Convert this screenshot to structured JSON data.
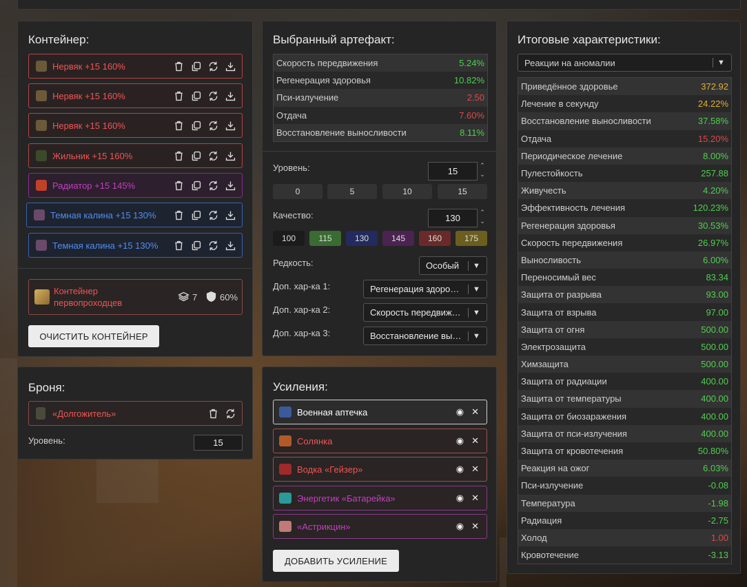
{
  "container": {
    "title": "Контейнер:",
    "items": [
      {
        "label": "Нервяк +15 160%",
        "color": "red",
        "art": "#6b5a3a"
      },
      {
        "label": "Нервяк +15 160%",
        "color": "red",
        "art": "#6b5a3a"
      },
      {
        "label": "Нервяк +15 160%",
        "color": "red",
        "art": "#6b5a3a"
      },
      {
        "label": "Жильник +15 160%",
        "color": "red",
        "art": "#3a4a2a"
      },
      {
        "label": "Радиатор +15 145%",
        "color": "purple",
        "art": "#c0402a"
      },
      {
        "label": "Темная калина +15 130%",
        "color": "blue",
        "art": "#6a4a6a"
      },
      {
        "label": "Темная калина +15 130%",
        "color": "blue",
        "art": "#6a4a6a"
      }
    ],
    "selected_container": {
      "name_line1": "Контейнер",
      "name_line2": "первопроходцев",
      "slots": "7",
      "protection": "60%"
    },
    "clear_button": "ОЧИСТИТЬ КОНТЕЙНЕР"
  },
  "armor": {
    "title": "Броня:",
    "item": "«Долгожитель»",
    "level_label": "Уровень:",
    "level_value": "15"
  },
  "artifact": {
    "title": "Выбранный артефакт:",
    "stats": [
      {
        "name": "Скорость передвижения",
        "value": "5.24%",
        "tone": "g"
      },
      {
        "name": "Регенерация здоровья",
        "value": "10.82%",
        "tone": "g"
      },
      {
        "name": "Пси-излучение",
        "value": "2.50",
        "tone": "r"
      },
      {
        "name": "Отдача",
        "value": "7.60%",
        "tone": "r"
      },
      {
        "name": "Восстановление выносливости",
        "value": "8.11%",
        "tone": "g"
      }
    ],
    "level_label": "Уровень:",
    "level_value": "15",
    "level_presets": [
      "0",
      "5",
      "10",
      "15"
    ],
    "quality_label": "Качество:",
    "quality_value": "130",
    "quality_presets": [
      {
        "label": "100",
        "color": "#1b1b1b"
      },
      {
        "label": "115",
        "color": "#3a6b32"
      },
      {
        "label": "130",
        "color": "#232a5e"
      },
      {
        "label": "145",
        "color": "#4a2350"
      },
      {
        "label": "160",
        "color": "#6b2a2a"
      },
      {
        "label": "175",
        "color": "#6b5e1e"
      }
    ],
    "rarity_label": "Редкость:",
    "rarity_value": "Особый",
    "extra1_label": "Доп. хар-ка 1:",
    "extra1_value": "Регенерация здоровья",
    "extra2_label": "Доп. хар-ка 2:",
    "extra2_value": "Скорость передвижения",
    "extra3_label": "Доп. хар-ка 3:",
    "extra3_value": "Восстановление выносливости"
  },
  "boosts": {
    "title": "Усиления:",
    "items": [
      {
        "label": "Военная аптечка",
        "border": "#cfcfcf",
        "text": "#ffffff",
        "art": "#3a5a9a"
      },
      {
        "label": "Солянка",
        "border": "#a05050",
        "text": "#f25454",
        "art": "#b05a2a"
      },
      {
        "label": "Водка «Гейзер»",
        "border": "#a05050",
        "text": "#f25454",
        "art": "#a02a2a"
      },
      {
        "label": "Энергетик «Батарейка»",
        "border": "#8a3a8a",
        "text": "#c43ec4",
        "art": "#2a9a9a"
      },
      {
        "label": "«Астрикцин»",
        "border": "#8a3a8a",
        "text": "#c43ec4",
        "art": "#c07a7a"
      }
    ],
    "add_button": "ДОБАВИТЬ УСИЛЕНИЕ"
  },
  "totals": {
    "title": "Итоговые характеристики:",
    "filter_value": "Реакции на аномалии",
    "stats": [
      {
        "name": "Приведённое здоровье",
        "value": "372.92",
        "tone": "y"
      },
      {
        "name": "Лечение в секунду",
        "value": "24.22%",
        "tone": "y"
      },
      {
        "name": "Восстановление выносливости",
        "value": "37.58%",
        "tone": "g"
      },
      {
        "name": "Отдача",
        "value": "15.20%",
        "tone": "r"
      },
      {
        "name": "Периодическое лечение",
        "value": "8.00%",
        "tone": "g"
      },
      {
        "name": "Пулестойкость",
        "value": "257.88",
        "tone": "g"
      },
      {
        "name": "Живучесть",
        "value": "4.20%",
        "tone": "g"
      },
      {
        "name": "Эффективность лечения",
        "value": "120.23%",
        "tone": "g"
      },
      {
        "name": "Регенерация здоровья",
        "value": "30.53%",
        "tone": "g"
      },
      {
        "name": "Скорость передвижения",
        "value": "26.97%",
        "tone": "g"
      },
      {
        "name": "Выносливость",
        "value": "6.00%",
        "tone": "g"
      },
      {
        "name": "Переносимый вес",
        "value": "83.34",
        "tone": "g"
      },
      {
        "name": "Защита от разрыва",
        "value": "93.00",
        "tone": "g"
      },
      {
        "name": "Защита от взрыва",
        "value": "97.00",
        "tone": "g"
      },
      {
        "name": "Защита от огня",
        "value": "500.00",
        "tone": "g"
      },
      {
        "name": "Электрозащита",
        "value": "500.00",
        "tone": "g"
      },
      {
        "name": "Химзащита",
        "value": "500.00",
        "tone": "g"
      },
      {
        "name": "Защита от радиации",
        "value": "400.00",
        "tone": "g"
      },
      {
        "name": "Защита от температуры",
        "value": "400.00",
        "tone": "g"
      },
      {
        "name": "Защита от биозаражения",
        "value": "400.00",
        "tone": "g"
      },
      {
        "name": "Защита от пси-излучения",
        "value": "400.00",
        "tone": "g"
      },
      {
        "name": "Защита от кровотечения",
        "value": "50.80%",
        "tone": "g"
      },
      {
        "name": "Реакция на ожог",
        "value": "6.03%",
        "tone": "g"
      },
      {
        "name": "Пси-излучение",
        "value": "-0.08",
        "tone": "g"
      },
      {
        "name": "Температура",
        "value": "-1.98",
        "tone": "g"
      },
      {
        "name": "Радиация",
        "value": "-2.75",
        "tone": "g"
      },
      {
        "name": "Холод",
        "value": "1.00",
        "tone": "r"
      },
      {
        "name": "Кровотечение",
        "value": "-3.13",
        "tone": "g"
      }
    ]
  }
}
